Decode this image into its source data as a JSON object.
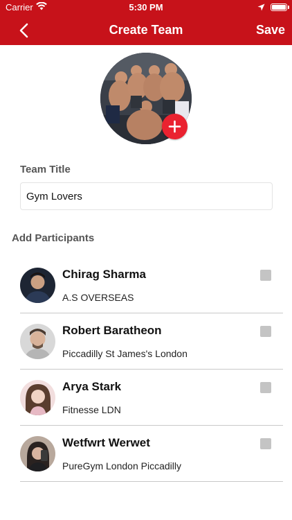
{
  "status_bar": {
    "carrier": "Carrier",
    "time": "5:30 PM"
  },
  "nav": {
    "title": "Create Team",
    "save_label": "Save"
  },
  "colors": {
    "accent": "#c7121a",
    "add_button": "#ea2230",
    "checkbox": "#c4c4c4"
  },
  "form": {
    "team_title_label": "Team Title",
    "team_title_value": "Gym Lovers",
    "participants_label": "Add Participants"
  },
  "participants": [
    {
      "name": "Chirag Sharma",
      "gym": "A.S OVERSEAS",
      "checked": false
    },
    {
      "name": "Robert Baratheon",
      "gym": "Piccadilly St James's London",
      "checked": false
    },
    {
      "name": "Arya Stark",
      "gym": "Fitnesse LDN",
      "checked": false
    },
    {
      "name": "Wetfwrt Werwet",
      "gym": "PureGym London Piccadilly",
      "checked": false
    }
  ]
}
